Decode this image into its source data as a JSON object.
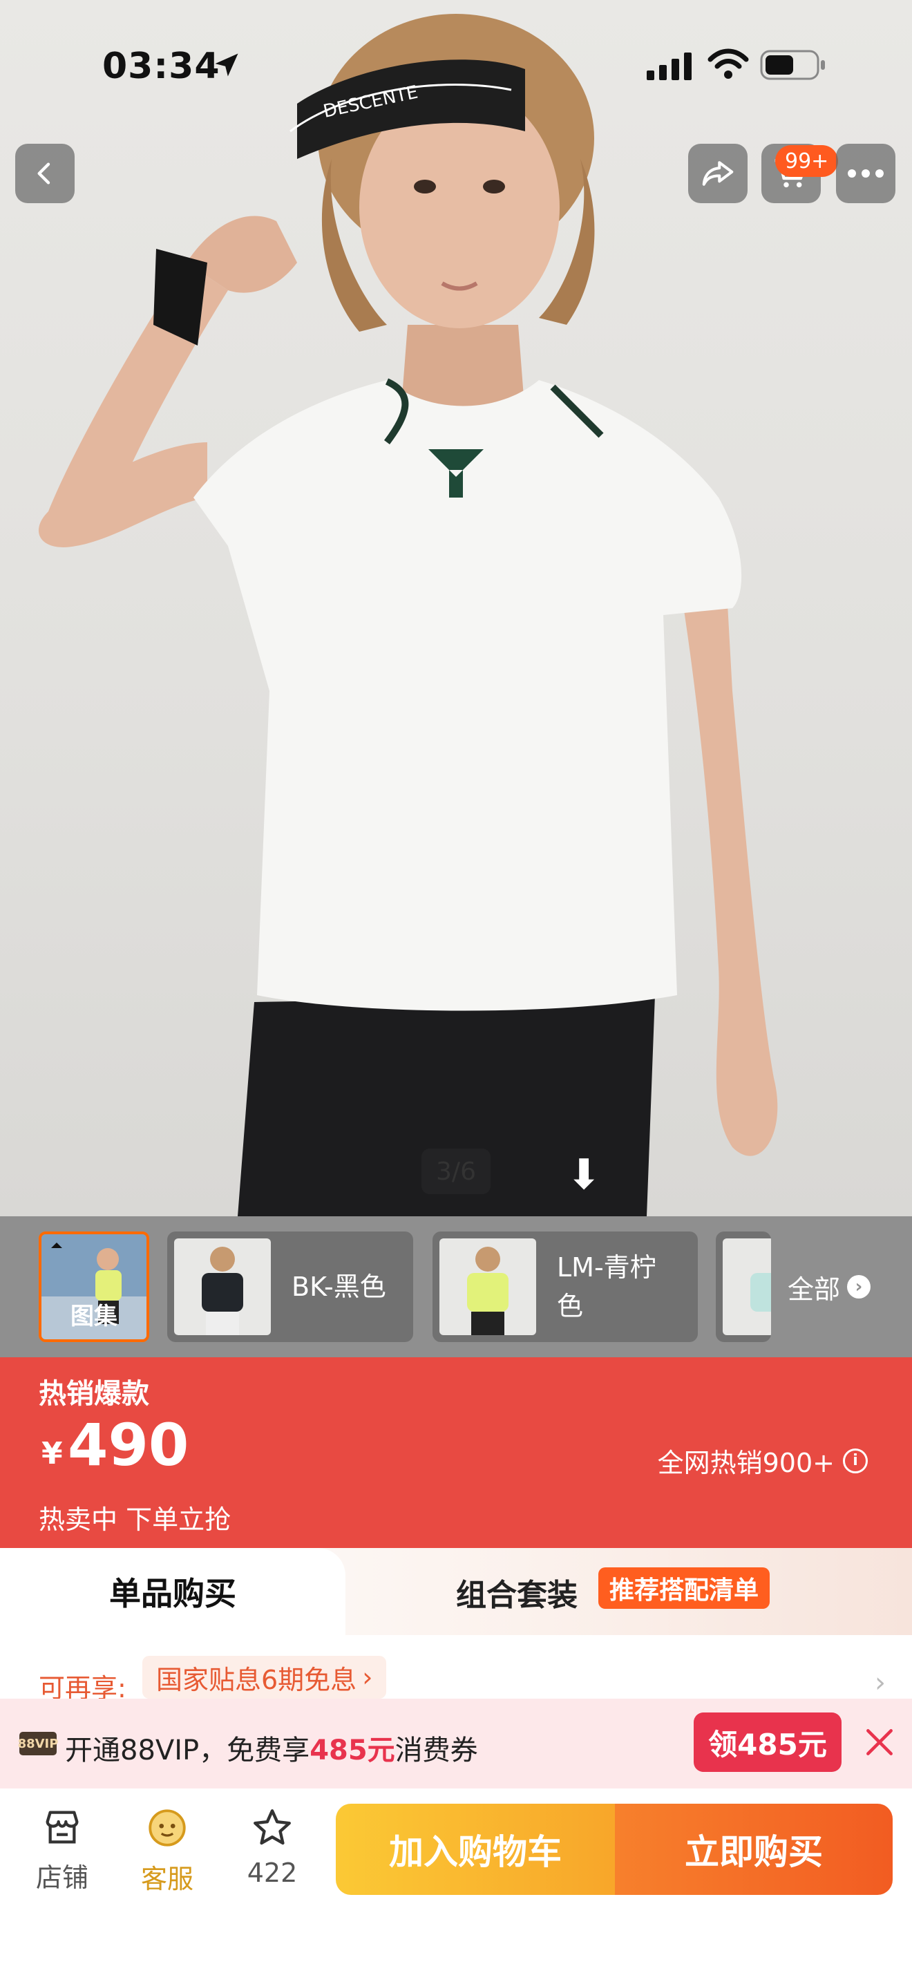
{
  "status_bar": {
    "time": "03:34"
  },
  "header": {
    "cart_badge": "99+"
  },
  "hero": {
    "page_indicator": "3/6",
    "visor_text": "DESCENTE"
  },
  "thumbnails": {
    "gallery_label": "图集",
    "variants": [
      {
        "label": "BK-黑色",
        "shirt_color": "#22262b"
      },
      {
        "label": "LM-青柠色",
        "shirt_color": "#e2f27a"
      },
      {
        "label": "",
        "shirt_color": "#bfe3de"
      }
    ],
    "all_label": "全部"
  },
  "price_banner": {
    "title": "热销爆款",
    "currency": "¥",
    "price": "490",
    "hot_sales": "全网热销900+",
    "promo": "热卖中 下单立抢"
  },
  "purchase_tabs": {
    "single": "单品购买",
    "combo": "组合套装",
    "combo_badge": "推荐搭配清单"
  },
  "benefit": {
    "label": "可再享:",
    "chip": "国家贴息6期免息"
  },
  "vip": {
    "logo": "88VIP",
    "text_prefix": "开通88VIP，免费享",
    "amount": "485元",
    "text_suffix": "消费券",
    "claim": "领485元"
  },
  "bottom_bar": {
    "store": "店铺",
    "service": "客服",
    "favorites_count": "422",
    "add_to_cart": "加入购物车",
    "buy_now": "立即购买"
  },
  "colors": {
    "accent_red": "#e84a42",
    "orange": "#ff5e1f",
    "vip_red": "#e8334d",
    "cart_yellow": "#f8b52e"
  }
}
